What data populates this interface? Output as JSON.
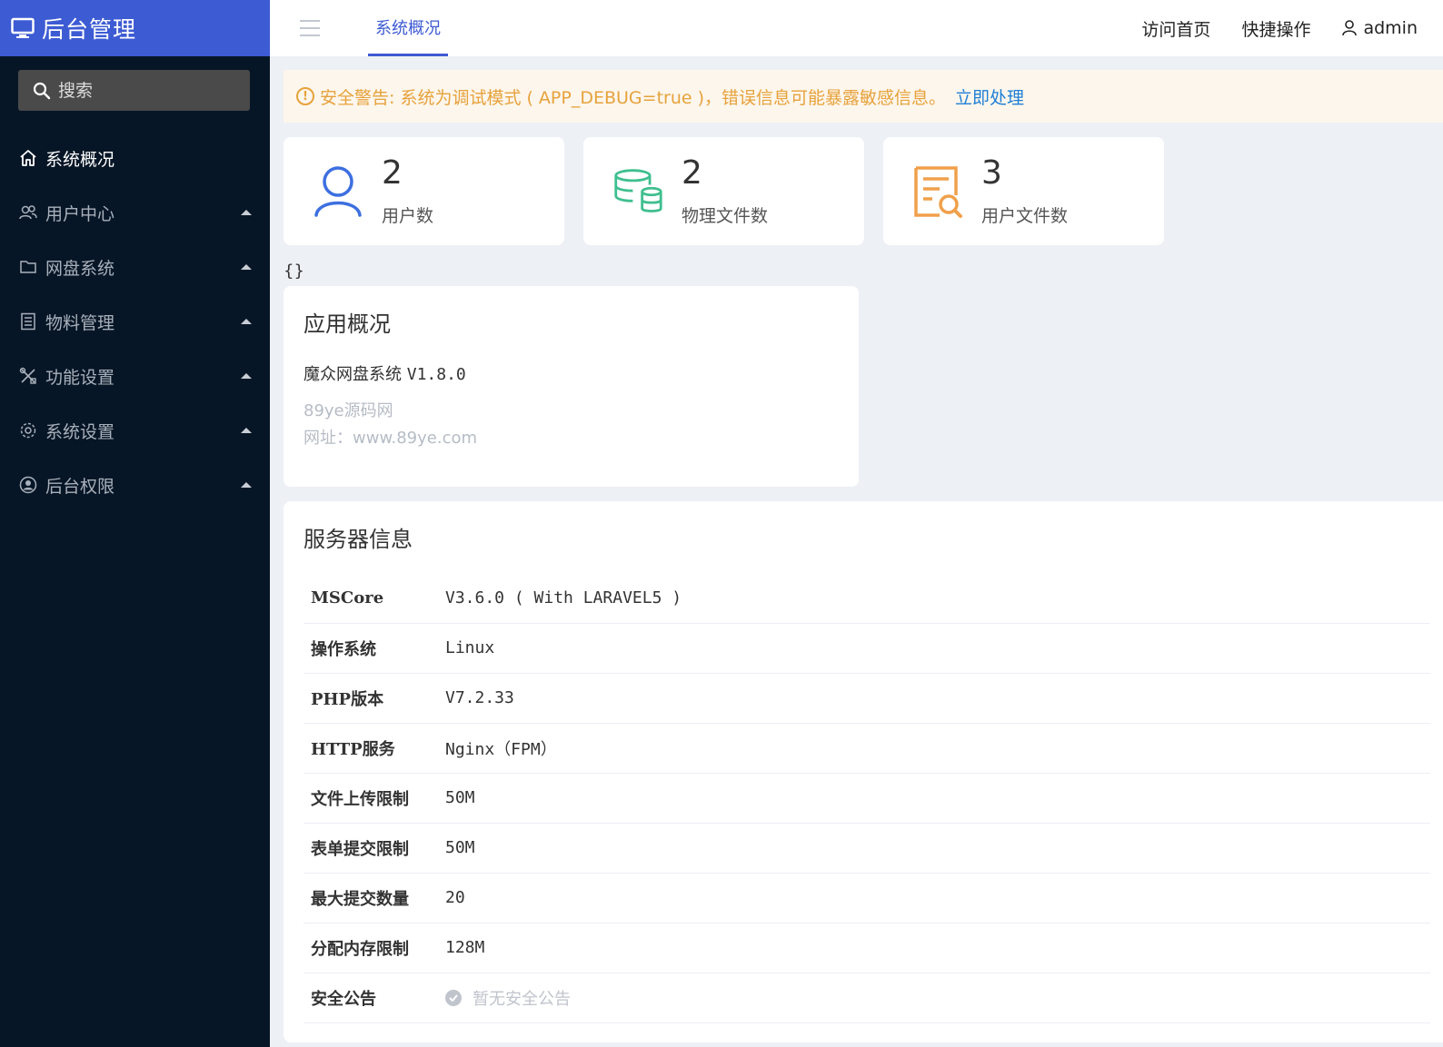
{
  "app": {
    "title": "后台管理"
  },
  "sidebar": {
    "search_placeholder": "搜索",
    "items": [
      {
        "label": "系统概况",
        "icon": "home-icon",
        "active": true
      },
      {
        "label": "用户中心",
        "icon": "users-icon"
      },
      {
        "label": "网盘系统",
        "icon": "folder-icon"
      },
      {
        "label": "物料管理",
        "icon": "list-icon"
      },
      {
        "label": "功能设置",
        "icon": "tools-icon"
      },
      {
        "label": "系统设置",
        "icon": "gear-icon"
      },
      {
        "label": "后台权限",
        "icon": "user-circle-icon"
      }
    ]
  },
  "header": {
    "tab": "系统概况",
    "links": {
      "home": "访问首页",
      "quick": "快捷操作",
      "user": "admin"
    }
  },
  "alert": {
    "text": "安全警告: 系统为调试模式 ( APP_DEBUG=true )，错误信息可能暴露敏感信息。",
    "action": "立即处理"
  },
  "stats": [
    {
      "value": "2",
      "label": "用户数",
      "icon": "user-icon",
      "color": "#3d6fe0"
    },
    {
      "value": "2",
      "label": "物理文件数",
      "icon": "database-icon",
      "color": "#3fbf8f"
    },
    {
      "value": "3",
      "label": "用户文件数",
      "icon": "file-search-icon",
      "color": "#f0a04b"
    }
  ],
  "braces": "{}",
  "app_overview": {
    "title": "应用概况",
    "name": "魔众网盘系统",
    "version": "V1.8.0",
    "site": "89ye源码网",
    "url": "网址：www.89ye.com"
  },
  "server": {
    "title": "服务器信息",
    "rows": [
      {
        "k": "MSCore",
        "v": "V3.6.0 ( With LARAVEL5 )"
      },
      {
        "k": "操作系统",
        "v": "Linux"
      },
      {
        "k": "PHP版本",
        "v": "V7.2.33"
      },
      {
        "k": "HTTP服务",
        "v": "Nginx（FPM）"
      },
      {
        "k": "文件上传限制",
        "v": "50M"
      },
      {
        "k": "表单提交限制",
        "v": "50M"
      },
      {
        "k": "最大提交数量",
        "v": "20"
      },
      {
        "k": "分配内存限制",
        "v": "128M"
      }
    ],
    "notice_label": "安全公告",
    "notice_value": "暂无安全公告"
  }
}
